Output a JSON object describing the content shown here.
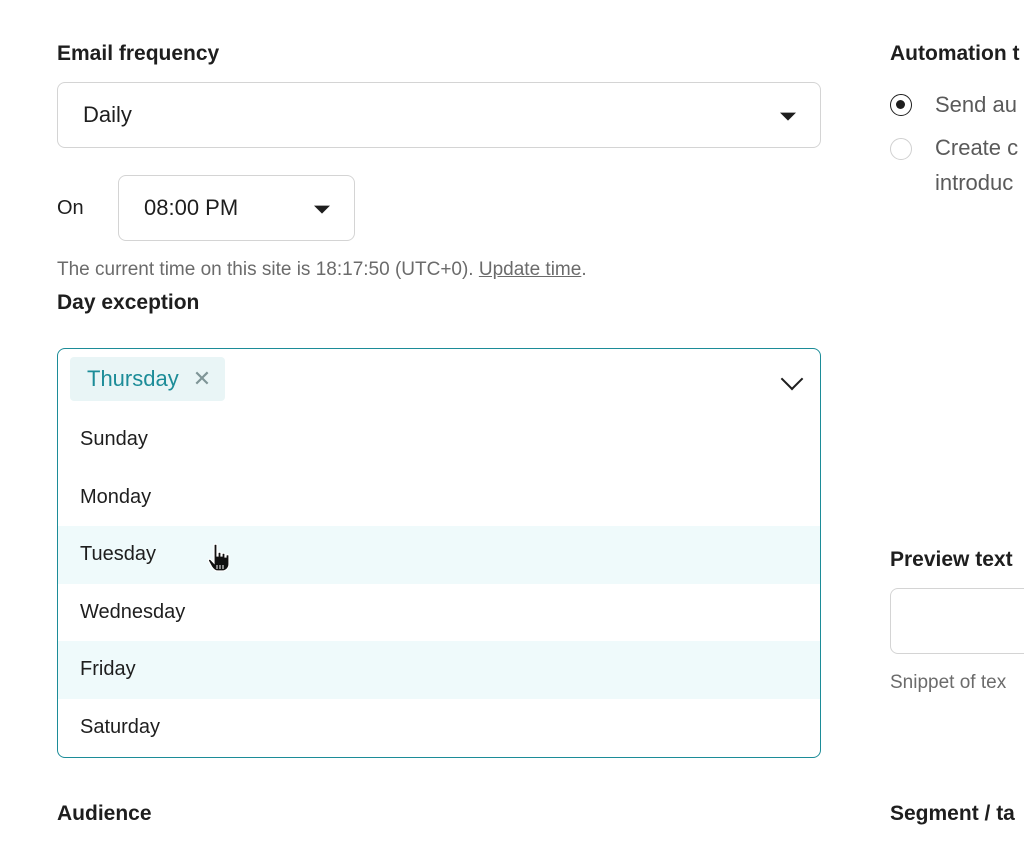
{
  "email_frequency": {
    "label": "Email frequency",
    "selected": "Daily"
  },
  "time": {
    "on_label": "On",
    "selected": "08:00 PM",
    "help_prefix": "The current time on this site is 18:17:50 (UTC+0). ",
    "help_link": "Update time",
    "help_suffix": "."
  },
  "day_exception": {
    "label": "Day exception",
    "selected_chip": "Thursday",
    "options": [
      "Sunday",
      "Monday",
      "Tuesday",
      "Wednesday",
      "Friday",
      "Saturday"
    ],
    "highlighted": [
      "Tuesday",
      "Friday"
    ]
  },
  "audience": {
    "label": "Audience"
  },
  "automation": {
    "label": "Automation t",
    "options": [
      {
        "text": "Send au",
        "selected": true
      },
      {
        "text": "Create c",
        "text2": "introduc",
        "selected": false
      }
    ]
  },
  "preview_text": {
    "label": "Preview text",
    "help": "Snippet of tex"
  },
  "segment": {
    "label": "Segment / ta"
  }
}
